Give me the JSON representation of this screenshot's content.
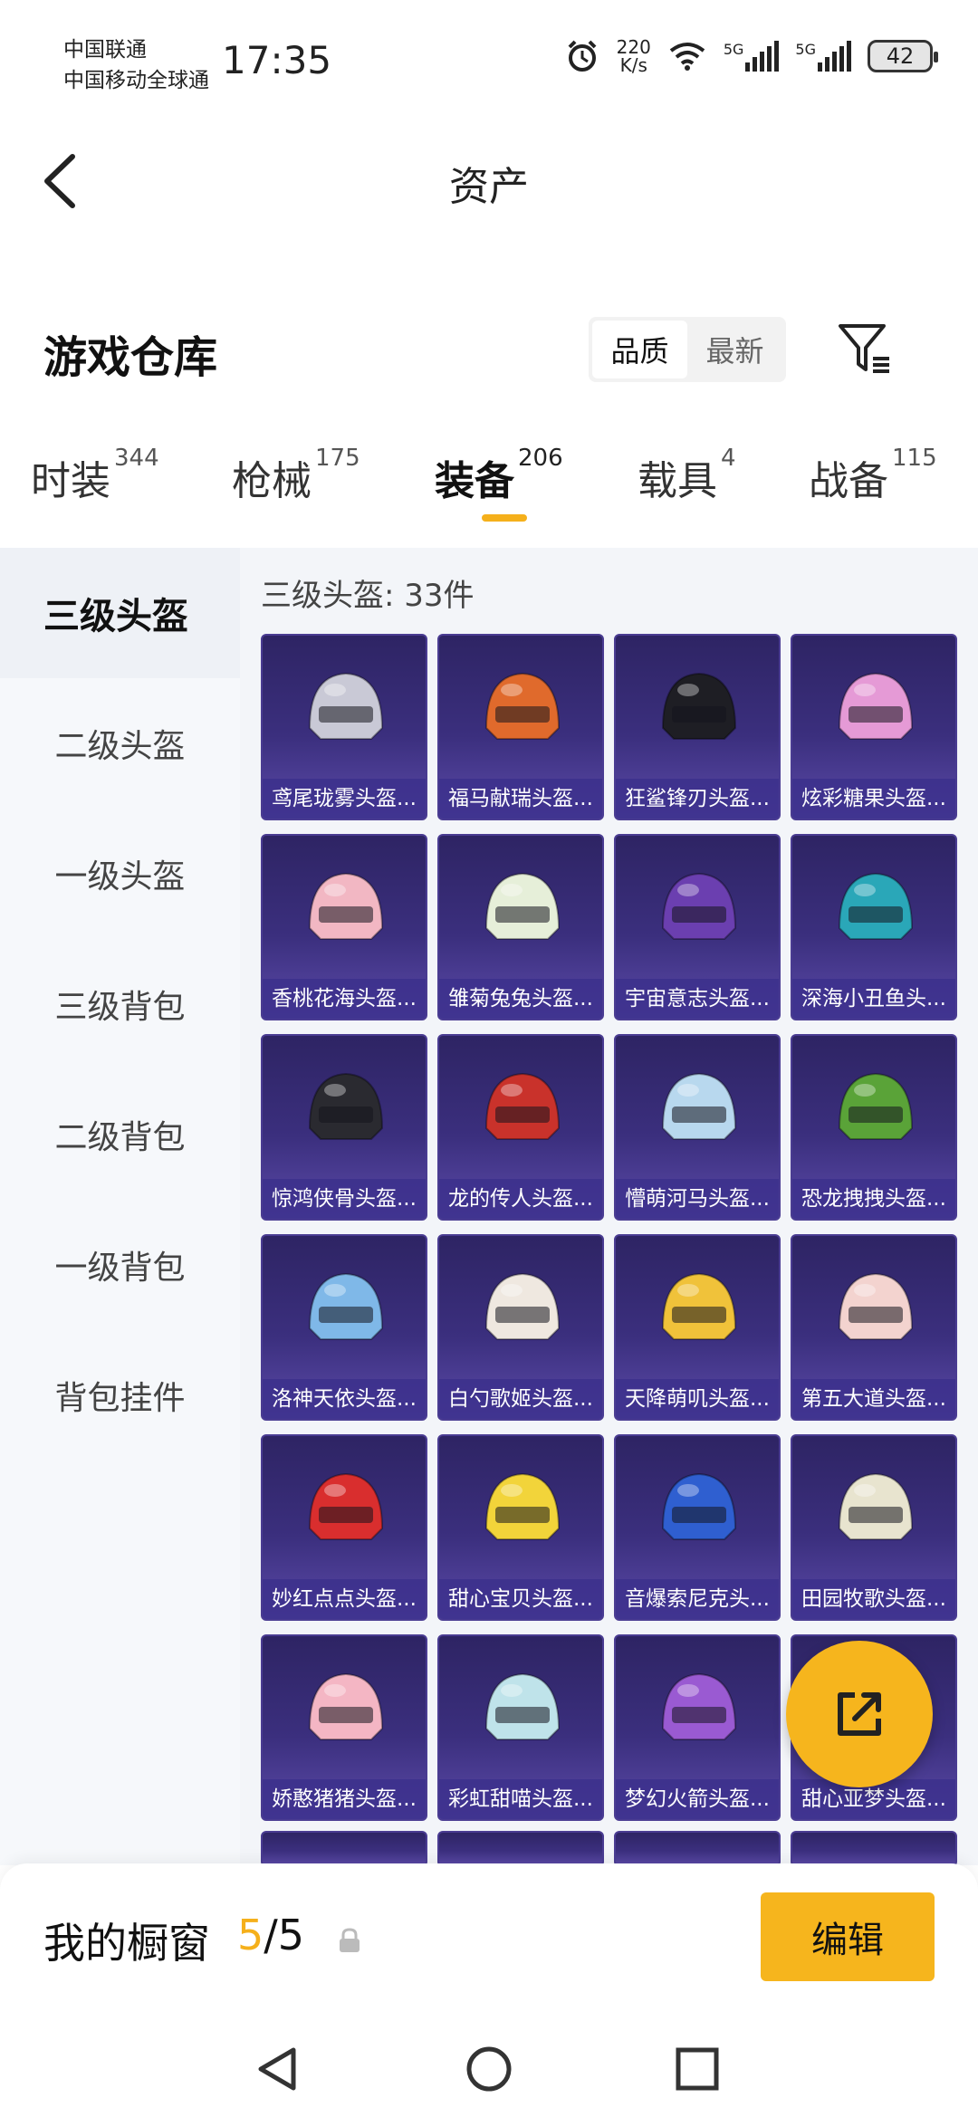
{
  "status_bar": {
    "carrier1": "中国联通",
    "carrier2": "中国移动全球通",
    "time": "17:35",
    "net_speed_value": "220",
    "net_speed_unit": "K/s",
    "signal1_label": "5G",
    "signal2_label": "5G",
    "battery": "42"
  },
  "header": {
    "title": "资产"
  },
  "warehouse": {
    "title": "游戏仓库",
    "sort_options": [
      "品质",
      "最新"
    ],
    "active_sort": "品质"
  },
  "tabs": [
    {
      "label": "时装",
      "count": "344"
    },
    {
      "label": "枪械",
      "count": "175"
    },
    {
      "label": "装备",
      "count": "206"
    },
    {
      "label": "载具",
      "count": "4"
    },
    {
      "label": "战备",
      "count": "115"
    }
  ],
  "active_tab": "装备",
  "sidebar": {
    "items": [
      "三级头盔",
      "二级头盔",
      "一级头盔",
      "三级背包",
      "二级背包",
      "一级背包",
      "背包挂件"
    ],
    "active": "三级头盔"
  },
  "grid": {
    "header": "三级头盔: 33件",
    "items": [
      {
        "name": "鸢尾珑雾头盔...",
        "color": "#c9c9d6"
      },
      {
        "name": "福马献瑞头盔...",
        "color": "#e06a2c"
      },
      {
        "name": "狂鲨锋刃头盔...",
        "color": "#1e1e24"
      },
      {
        "name": "炫彩糖果头盔...",
        "color": "#e59ad6"
      },
      {
        "name": "香桃花海头盔...",
        "color": "#f2b7c3"
      },
      {
        "name": "雏菊兔兔头盔...",
        "color": "#e6efd9"
      },
      {
        "name": "宇宙意志头盔...",
        "color": "#6b3fb0"
      },
      {
        "name": "深海小丑鱼头...",
        "color": "#2aa7b8"
      },
      {
        "name": "惊鸿侠骨头盔...",
        "color": "#2a2a30"
      },
      {
        "name": "龙的传人头盔...",
        "color": "#c9322b"
      },
      {
        "name": "懵萌河马头盔...",
        "color": "#b8d8ee"
      },
      {
        "name": "恐龙拽拽头盔...",
        "color": "#5aa338"
      },
      {
        "name": "洛神天依头盔...",
        "color": "#7fb8e8"
      },
      {
        "name": "白勺歌姬头盔...",
        "color": "#efe8e0"
      },
      {
        "name": "天降萌叽头盔...",
        "color": "#f0c23a"
      },
      {
        "name": "第五大道头盔...",
        "color": "#f3d3cf"
      },
      {
        "name": "妙红点点头盔...",
        "color": "#d92e2e"
      },
      {
        "name": "甜心宝贝头盔...",
        "color": "#f2d43a"
      },
      {
        "name": "音爆索尼克头...",
        "color": "#2f5fd0"
      },
      {
        "name": "田园牧歌头盔...",
        "color": "#e8e4cf"
      },
      {
        "name": "娇憨猪猪头盔...",
        "color": "#f4b6c4"
      },
      {
        "name": "彩虹甜喵头盔...",
        "color": "#bfe3ea"
      },
      {
        "name": "梦幻火箭头盔...",
        "color": "#9a5ad2"
      },
      {
        "name": "甜心亚梦头盔...",
        "color": "#f0b9cc"
      }
    ]
  },
  "showcase": {
    "title": "我的橱窗",
    "current": "5",
    "separator": "/",
    "total": "5",
    "edit_label": "编辑"
  },
  "colors": {
    "accent": "#f5b01b",
    "card_bg": "#3b2f7e"
  }
}
